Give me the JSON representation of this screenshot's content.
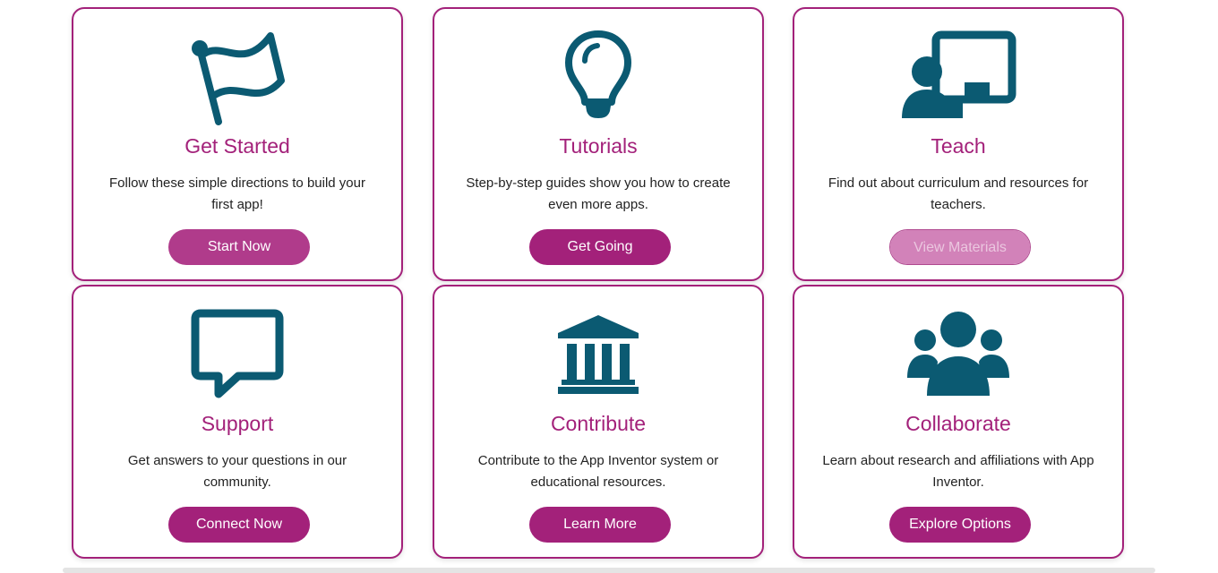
{
  "colors": {
    "accent": "#a3217a",
    "icon": "#0b5a72",
    "text": "#222222"
  },
  "cards": [
    {
      "icon": "flag-icon",
      "title": "Get Started",
      "description": "Follow these simple directions to build your first app!",
      "button": "Start Now"
    },
    {
      "icon": "lightbulb-icon",
      "title": "Tutorials",
      "description": "Step-by-step guides show you how to create even more apps.",
      "button": "Get Going"
    },
    {
      "icon": "teacher-board-icon",
      "title": "Teach",
      "description": "Find out about curriculum and resources for teachers.",
      "button": "View Materials"
    },
    {
      "icon": "speech-bubble-icon",
      "title": "Support",
      "description": "Get answers to your questions in our community.",
      "button": "Connect Now"
    },
    {
      "icon": "institution-icon",
      "title": "Contribute",
      "description": "Contribute to the App Inventor system or educational resources.",
      "button": "Learn More"
    },
    {
      "icon": "people-group-icon",
      "title": "Collaborate",
      "description": "Learn about research and affiliations with App Inventor.",
      "button": "Explore Options"
    }
  ]
}
